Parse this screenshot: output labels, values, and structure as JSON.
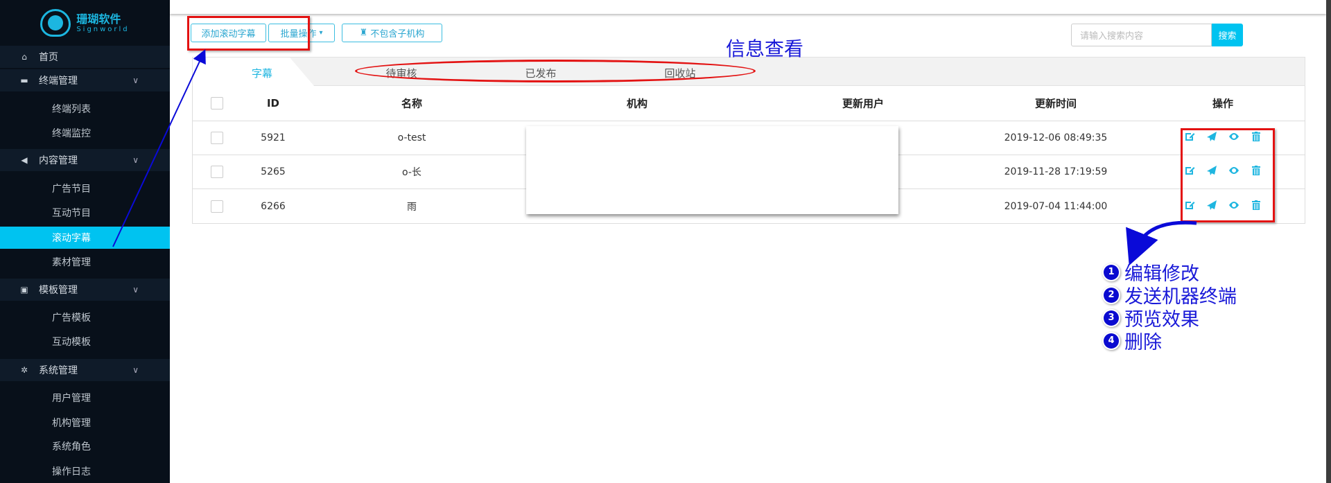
{
  "brand": {
    "name": "珊瑚软件",
    "sub": "Signworld"
  },
  "sidebar": {
    "items": [
      {
        "label": "首页",
        "type": "group",
        "icon": "home-icon",
        "glyph": "⌂"
      },
      {
        "label": "终端管理",
        "type": "group",
        "icon": "monitor-icon",
        "glyph": "▬",
        "chev": "∨"
      },
      {
        "label": "终端列表",
        "type": "sub"
      },
      {
        "label": "终端监控",
        "type": "sub"
      },
      {
        "label": "内容管理",
        "type": "group",
        "icon": "send-icon",
        "glyph": "◀",
        "chev": "∨"
      },
      {
        "label": "广告节目",
        "type": "sub"
      },
      {
        "label": "互动节目",
        "type": "sub"
      },
      {
        "label": "滚动字幕",
        "type": "sub",
        "active": true
      },
      {
        "label": "素材管理",
        "type": "sub"
      },
      {
        "label": "模板管理",
        "type": "group",
        "icon": "template-icon",
        "glyph": "▣",
        "chev": "∨"
      },
      {
        "label": "广告模板",
        "type": "sub"
      },
      {
        "label": "互动模板",
        "type": "sub"
      },
      {
        "label": "系统管理",
        "type": "group",
        "icon": "gear-icon",
        "glyph": "✲",
        "chev": "∨"
      },
      {
        "label": "用户管理",
        "type": "sub"
      },
      {
        "label": "机构管理",
        "type": "sub"
      },
      {
        "label": "系统角色",
        "type": "sub"
      },
      {
        "label": "操作日志",
        "type": "sub"
      }
    ]
  },
  "toolbar": {
    "add": "添加滚动字幕",
    "batch": "批量操作",
    "batch_caret": "▾",
    "exclude": "不包含子机构"
  },
  "search": {
    "placeholder": "请输入搜索内容",
    "button": "搜索"
  },
  "tabs": [
    "字幕",
    "待审核",
    "已发布",
    "回收站"
  ],
  "table": {
    "headers": [
      "ID",
      "名称",
      "机构",
      "更新用户",
      "更新时间",
      "操作"
    ],
    "rows": [
      {
        "id": "5921",
        "name": "o-test",
        "time": "2019-12-06 08:49:35"
      },
      {
        "id": "5265",
        "name": "o-长",
        "time": "2019-11-28 17:19:59"
      },
      {
        "id": "6266",
        "name": "雨",
        "time": "2019-07-04 11:44:00"
      }
    ]
  },
  "annotations": {
    "info": "信息查看",
    "legend": [
      {
        "num": "1",
        "text": "编辑修改"
      },
      {
        "num": "2",
        "text": "发送机器终端"
      },
      {
        "num": "3",
        "text": "预览效果"
      },
      {
        "num": "4",
        "text": "删除"
      }
    ]
  },
  "colors": {
    "accent": "#00c3f0",
    "annotation": "#1919d8",
    "highlight": "#e31212"
  }
}
